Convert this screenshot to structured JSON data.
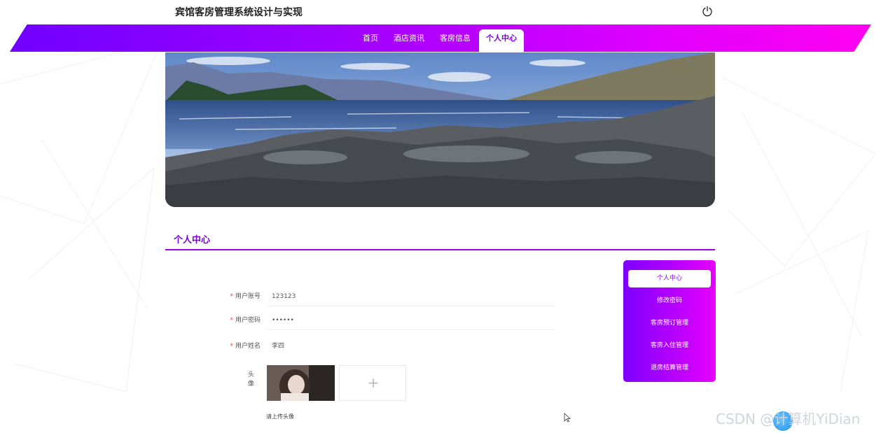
{
  "header": {
    "title": "宾馆客房管理系统设计与实现",
    "power_icon": "power-icon"
  },
  "nav": {
    "items": [
      {
        "label": "首页",
        "active": false
      },
      {
        "label": "酒店资讯",
        "active": false
      },
      {
        "label": "客房信息",
        "active": false
      },
      {
        "label": "个人中心",
        "active": true
      }
    ]
  },
  "section": {
    "title": "个人中心"
  },
  "form": {
    "username": {
      "label": "用户账号",
      "value": "123123"
    },
    "password": {
      "label": "用户密码",
      "value": "••••••"
    },
    "realname": {
      "label": "用户姓名",
      "value": "李四"
    },
    "avatar": {
      "label": "头像",
      "hint": "请上传头像",
      "upload_symbol": "+"
    }
  },
  "side_menu": {
    "items": [
      {
        "label": "个人中心",
        "active": true
      },
      {
        "label": "修改密码",
        "active": false
      },
      {
        "label": "客房预订管理",
        "active": false
      },
      {
        "label": "客房入住管理",
        "active": false
      },
      {
        "label": "退房结算管理",
        "active": false
      }
    ]
  },
  "watermark": "CSDN @计算机YiDian",
  "colors": {
    "accent": "#7a00e0",
    "gradient_start": "#7000ff",
    "gradient_end": "#ff00f0"
  }
}
